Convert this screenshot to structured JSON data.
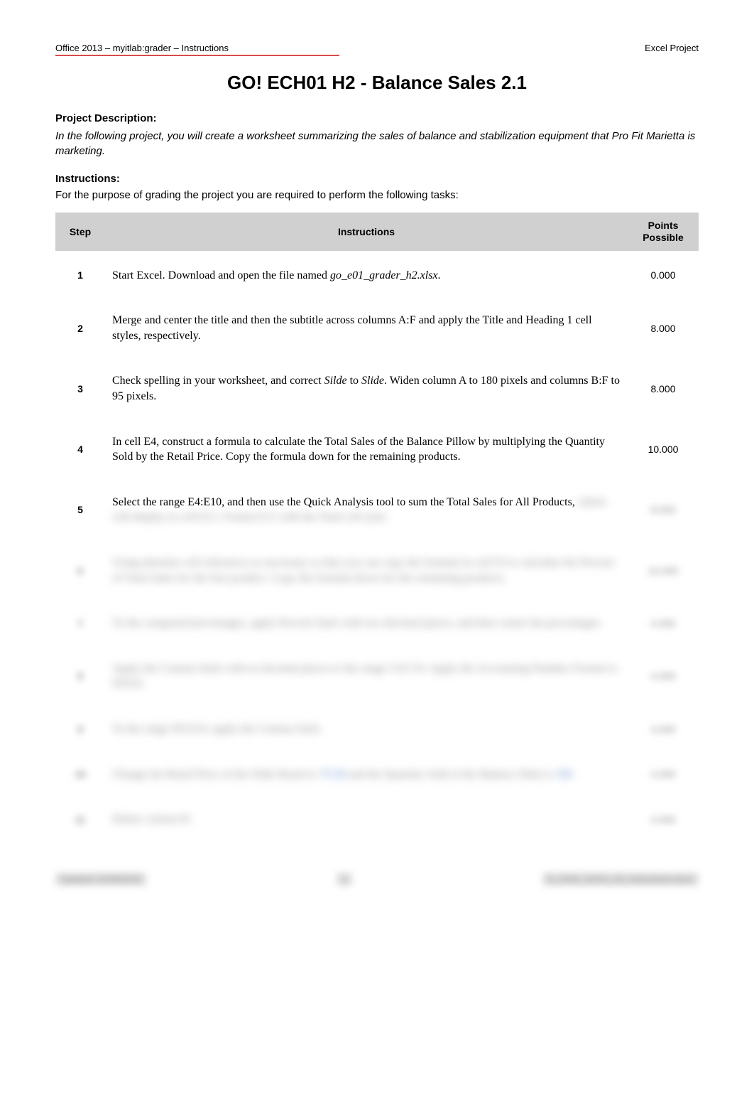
{
  "header": {
    "left": "Office 2013 – myitlab:grader – Instructions",
    "right": "Excel Project"
  },
  "title": "GO! ECH01 H2 - Balance Sales 2.1",
  "project_description_heading": "Project Description:",
  "project_description_body": "In the following project, you will create a worksheet summarizing the sales of balance and stabilization equipment that Pro Fit Marietta is marketing.",
  "instructions_heading": "Instructions:",
  "instructions_intro": "For the purpose of grading the project you are required to perform the following tasks:",
  "table": {
    "col_step": "Step",
    "col_instructions": "Instructions",
    "col_points_l1": "Points",
    "col_points_l2": "Possible"
  },
  "steps": [
    {
      "num": "1",
      "instr_prefix": "Start Excel. Download and open the file named ",
      "instr_em": "go_e01_grader_h2.xlsx",
      "instr_suffix": ".",
      "points": "0.000"
    },
    {
      "num": "2",
      "instr_full": "Merge and center the title and then the subtitle across columns A:F and apply the Title and Heading 1 cell styles, respectively.",
      "points": "8.000"
    },
    {
      "num": "3",
      "instr_prefix": "Check spelling in your worksheet, and correct ",
      "instr_em1": "Silde",
      "instr_mid": " to ",
      "instr_em2": "Slide",
      "instr_suffix": ". Widen column A to 180 pixels and columns B:F to 95 pixels.",
      "points": "8.000"
    },
    {
      "num": "4",
      "instr_full": "In cell E4, construct a formula to calculate the Total Sales of the Balance Pillow by multiplying the Quantity Sold by the Retail Price. Copy the formula down for the remaining products.",
      "points": "10.000"
    },
    {
      "num": "5",
      "instr_visible": "Select the range E4:E10, and then use the Quick Analysis tool to sum the Total Sales for All Products,",
      "instr_hidden": "which will display in cell E11. Format E11 with the Total cell style.",
      "points_hidden": "8.000"
    },
    {
      "num_hidden": "6",
      "instr_hidden": "Using absolute cell references as necessary so that you can copy the formula in cell F4 to calculate the Percent of Total Sales for the first product. Copy the formula down for the remaining products.",
      "points_hidden": "10.000"
    },
    {
      "num_hidden": "7",
      "instr_hidden": "To the computed percentages, apply Percent Style with two decimal places, and then center the percentages.",
      "points_hidden": "4.000"
    },
    {
      "num_hidden": "8",
      "instr_hidden": "Apply the Comma Style with no decimal places to the range C4:C10. Apply the Accounting Number Format to D4:E4.",
      "points_hidden": "4.000"
    },
    {
      "num_hidden": "9",
      "instr_hidden": "To the range D5:E10, apply the Comma Style.",
      "points_hidden": "4.000"
    },
    {
      "num_hidden": "10",
      "instr_hidden_pre": "Change the Retail Price of the Slide Board to ",
      "instr_hidden_blue1": "75.50",
      "instr_hidden_mid": " and the Quantity Sold of the Balance Disk to ",
      "instr_hidden_blue2": "150",
      "points_hidden": "4.000"
    },
    {
      "num_hidden": "11",
      "instr_hidden": "Delete column B.",
      "points_hidden": "4.000"
    }
  ],
  "footer": {
    "left_hidden": "Updated: 01/08/2015",
    "center": "1",
    "right_hidden": "E_CH01_GOV1_H2_Instructions.docx"
  }
}
